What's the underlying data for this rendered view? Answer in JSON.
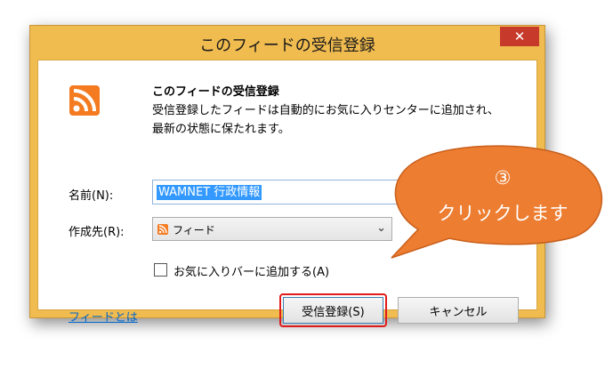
{
  "dialog": {
    "title": "このフィードの受信登録",
    "close_glyph": "✕",
    "heading": "このフィードの受信登録",
    "description": "受信登録したフィードは自動的にお気に入りセンターに追加され、最新の状態に保たれます。",
    "name_label": "名前(N):",
    "name_value": "WAMNET 行政情報",
    "dest_label": "作成先(R):",
    "dest_value": "フィード",
    "dropdown_glyph": "⌄",
    "favbar_label": "お気に入りバーに追加する(A)",
    "favbar_checked": false,
    "about_link": "フィードとは",
    "subscribe_button": "受信登録(S)",
    "cancel_button": "キャンセル"
  },
  "callout": {
    "number": "③",
    "message": "クリックします",
    "color": "#ed7d31"
  },
  "colors": {
    "window_frame": "#f0bb4f",
    "close_button": "#c7392b",
    "rss_orange": "#f47b20",
    "highlight": "#e11b1b",
    "selection": "#3399ff",
    "link": "#0066cc"
  },
  "icons": {
    "feed": "rss-icon",
    "close": "close-icon",
    "dropdown": "chevron-down-icon"
  }
}
